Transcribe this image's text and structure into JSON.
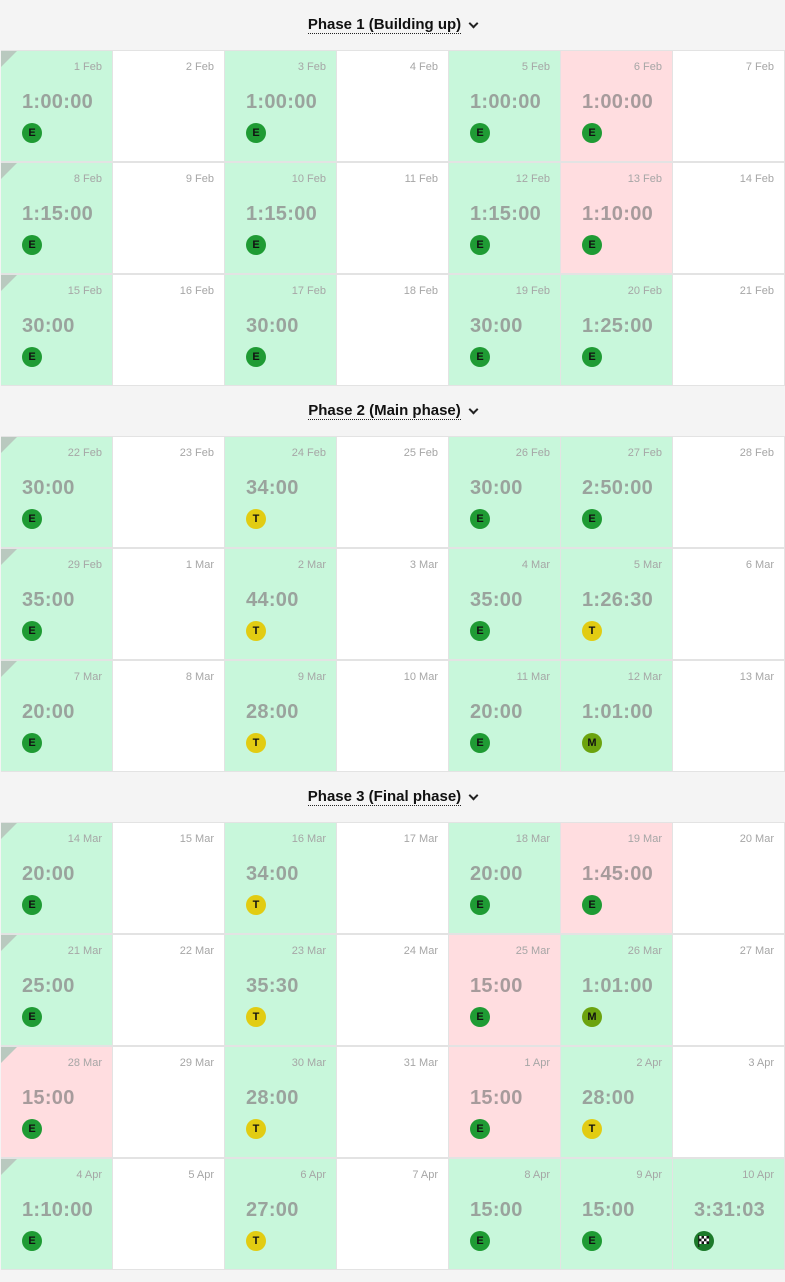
{
  "colors": {
    "done": "#c8f7db",
    "missed": "#ffdde0",
    "empty": "#ffffff",
    "badge_E": "#1f9b34",
    "badge_T": "#e2cc12",
    "badge_M": "#6ca30e"
  },
  "phases": [
    {
      "title": "Phase 1 (Building up)",
      "icon": "chevron-down-icon",
      "days": [
        {
          "date": "1 Feb",
          "duration": "1:00:00",
          "badge": "E",
          "status": "done",
          "week_start": true
        },
        {
          "date": "2 Feb",
          "status": "empty"
        },
        {
          "date": "3 Feb",
          "duration": "1:00:00",
          "badge": "E",
          "status": "done"
        },
        {
          "date": "4 Feb",
          "status": "empty"
        },
        {
          "date": "5 Feb",
          "duration": "1:00:00",
          "badge": "E",
          "status": "done"
        },
        {
          "date": "6 Feb",
          "duration": "1:00:00",
          "badge": "E",
          "status": "missed"
        },
        {
          "date": "7 Feb",
          "status": "empty"
        },
        {
          "date": "8 Feb",
          "duration": "1:15:00",
          "badge": "E",
          "status": "done",
          "week_start": true
        },
        {
          "date": "9 Feb",
          "status": "empty"
        },
        {
          "date": "10 Feb",
          "duration": "1:15:00",
          "badge": "E",
          "status": "done"
        },
        {
          "date": "11 Feb",
          "status": "empty"
        },
        {
          "date": "12 Feb",
          "duration": "1:15:00",
          "badge": "E",
          "status": "done"
        },
        {
          "date": "13 Feb",
          "duration": "1:10:00",
          "badge": "E",
          "status": "missed"
        },
        {
          "date": "14 Feb",
          "status": "empty"
        },
        {
          "date": "15 Feb",
          "duration": "30:00",
          "badge": "E",
          "status": "done",
          "week_start": true
        },
        {
          "date": "16 Feb",
          "status": "empty"
        },
        {
          "date": "17 Feb",
          "duration": "30:00",
          "badge": "E",
          "status": "done"
        },
        {
          "date": "18 Feb",
          "status": "empty"
        },
        {
          "date": "19 Feb",
          "duration": "30:00",
          "badge": "E",
          "status": "done"
        },
        {
          "date": "20 Feb",
          "duration": "1:25:00",
          "badge": "E",
          "status": "done"
        },
        {
          "date": "21 Feb",
          "status": "empty"
        }
      ]
    },
    {
      "title": "Phase 2 (Main phase)",
      "icon": "chevron-down-icon",
      "days": [
        {
          "date": "22 Feb",
          "duration": "30:00",
          "badge": "E",
          "status": "done",
          "week_start": true
        },
        {
          "date": "23 Feb",
          "status": "empty"
        },
        {
          "date": "24 Feb",
          "duration": "34:00",
          "badge": "T",
          "status": "done"
        },
        {
          "date": "25 Feb",
          "status": "empty"
        },
        {
          "date": "26 Feb",
          "duration": "30:00",
          "badge": "E",
          "status": "done"
        },
        {
          "date": "27 Feb",
          "duration": "2:50:00",
          "badge": "E",
          "status": "done"
        },
        {
          "date": "28 Feb",
          "status": "empty"
        },
        {
          "date": "29 Feb",
          "duration": "35:00",
          "badge": "E",
          "status": "done",
          "week_start": true
        },
        {
          "date": "1 Mar",
          "status": "empty"
        },
        {
          "date": "2 Mar",
          "duration": "44:00",
          "badge": "T",
          "status": "done"
        },
        {
          "date": "3 Mar",
          "status": "empty"
        },
        {
          "date": "4 Mar",
          "duration": "35:00",
          "badge": "E",
          "status": "done"
        },
        {
          "date": "5 Mar",
          "duration": "1:26:30",
          "badge": "T",
          "status": "done"
        },
        {
          "date": "6 Mar",
          "status": "empty"
        },
        {
          "date": "7 Mar",
          "duration": "20:00",
          "badge": "E",
          "status": "done",
          "week_start": true
        },
        {
          "date": "8 Mar",
          "status": "empty"
        },
        {
          "date": "9 Mar",
          "duration": "28:00",
          "badge": "T",
          "status": "done"
        },
        {
          "date": "10 Mar",
          "status": "empty"
        },
        {
          "date": "11 Mar",
          "duration": "20:00",
          "badge": "E",
          "status": "done"
        },
        {
          "date": "12 Mar",
          "duration": "1:01:00",
          "badge": "M",
          "status": "done"
        },
        {
          "date": "13 Mar",
          "status": "empty"
        }
      ]
    },
    {
      "title": "Phase 3 (Final phase)",
      "icon": "chevron-down-icon",
      "days": [
        {
          "date": "14 Mar",
          "duration": "20:00",
          "badge": "E",
          "status": "done",
          "week_start": true
        },
        {
          "date": "15 Mar",
          "status": "empty"
        },
        {
          "date": "16 Mar",
          "duration": "34:00",
          "badge": "T",
          "status": "done"
        },
        {
          "date": "17 Mar",
          "status": "empty"
        },
        {
          "date": "18 Mar",
          "duration": "20:00",
          "badge": "E",
          "status": "done"
        },
        {
          "date": "19 Mar",
          "duration": "1:45:00",
          "badge": "E",
          "status": "missed"
        },
        {
          "date": "20 Mar",
          "status": "empty"
        },
        {
          "date": "21 Mar",
          "duration": "25:00",
          "badge": "E",
          "status": "done",
          "week_start": true
        },
        {
          "date": "22 Mar",
          "status": "empty"
        },
        {
          "date": "23 Mar",
          "duration": "35:30",
          "badge": "T",
          "status": "done"
        },
        {
          "date": "24 Mar",
          "status": "empty"
        },
        {
          "date": "25 Mar",
          "duration": "15:00",
          "badge": "E",
          "status": "missed"
        },
        {
          "date": "26 Mar",
          "duration": "1:01:00",
          "badge": "M",
          "status": "done"
        },
        {
          "date": "27 Mar",
          "status": "empty"
        },
        {
          "date": "28 Mar",
          "duration": "15:00",
          "badge": "E",
          "status": "missed",
          "week_start": true
        },
        {
          "date": "29 Mar",
          "status": "empty"
        },
        {
          "date": "30 Mar",
          "duration": "28:00",
          "badge": "T",
          "status": "done"
        },
        {
          "date": "31 Mar",
          "status": "empty"
        },
        {
          "date": "1 Apr",
          "duration": "15:00",
          "badge": "E",
          "status": "missed"
        },
        {
          "date": "2 Apr",
          "duration": "28:00",
          "badge": "T",
          "status": "done"
        },
        {
          "date": "3 Apr",
          "status": "empty"
        },
        {
          "date": "4 Apr",
          "duration": "1:10:00",
          "badge": "E",
          "status": "done",
          "week_start": true
        },
        {
          "date": "5 Apr",
          "status": "empty"
        },
        {
          "date": "6 Apr",
          "duration": "27:00",
          "badge": "T",
          "status": "done"
        },
        {
          "date": "7 Apr",
          "status": "empty"
        },
        {
          "date": "8 Apr",
          "duration": "15:00",
          "badge": "E",
          "status": "done"
        },
        {
          "date": "9 Apr",
          "duration": "15:00",
          "badge": "E",
          "status": "done"
        },
        {
          "date": "10 Apr",
          "duration": "3:31:03",
          "badge": "race-flag-icon",
          "status": "done"
        }
      ]
    }
  ]
}
